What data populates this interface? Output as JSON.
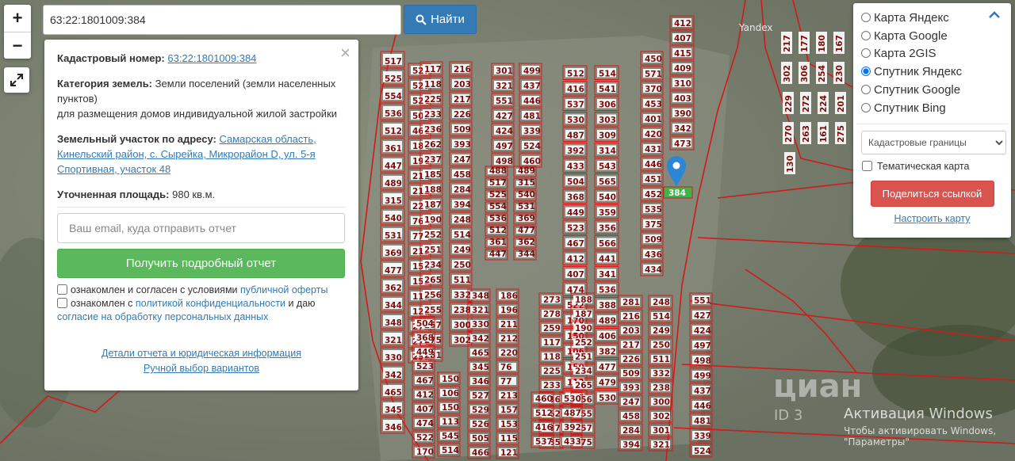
{
  "map": {
    "yandex_logo": "Yandex",
    "marker_label": "384",
    "plot_labels": [
      "517",
      "525",
      "554",
      "536",
      "512",
      "361",
      "447",
      "489",
      "315",
      "540",
      "531",
      "369",
      "477",
      "362",
      "344",
      "348",
      "321",
      "330",
      "342",
      "465",
      "345",
      "346",
      "527",
      "529",
      "526",
      "505",
      "466",
      "186",
      "196",
      "211",
      "212",
      "220",
      "76",
      "77",
      "213",
      "157",
      "153",
      "115",
      "121",
      "273",
      "278",
      "259",
      "117",
      "118",
      "225",
      "233",
      "236",
      "262",
      "237",
      "185",
      "188",
      "187",
      "190",
      "252",
      "251",
      "234",
      "265",
      "256",
      "255",
      "257",
      "275",
      "281",
      "216",
      "203",
      "217",
      "226",
      "509",
      "393",
      "247",
      "458",
      "284",
      "394",
      "248",
      "514",
      "249",
      "250",
      "511",
      "332",
      "238",
      "300",
      "302",
      "301",
      "321",
      "551",
      "427",
      "424",
      "497",
      "498",
      "499",
      "437",
      "446",
      "481",
      "339",
      "524",
      "460",
      "512",
      "416",
      "537",
      "530",
      "487",
      "392",
      "433",
      "504",
      "368",
      "449",
      "523",
      "467",
      "412",
      "407",
      "474",
      "522",
      "170",
      "150",
      "106",
      "150",
      "113",
      "545",
      "514",
      "541",
      "306",
      "303",
      "309",
      "314",
      "543",
      "565",
      "540",
      "359",
      "356",
      "566",
      "441",
      "341",
      "536",
      "388",
      "489",
      "406",
      "382",
      "477",
      "479",
      "530",
      "450",
      "571",
      "370",
      "453",
      "401",
      "420",
      "431",
      "446",
      "451",
      "452",
      "535",
      "375",
      "509",
      "436",
      "434",
      "412",
      "407",
      "415",
      "409",
      "310",
      "403",
      "390",
      "342",
      "473",
      "488"
    ],
    "right_labels": [
      "217",
      "177",
      "180",
      "167",
      "302",
      "306",
      "254",
      "230",
      "229",
      "272",
      "224",
      "201",
      "270",
      "263",
      "161",
      "275",
      "130"
    ]
  },
  "zoom": {
    "in": "+",
    "out": "−"
  },
  "search": {
    "value": "63:22:1801009:384",
    "button": "Найти"
  },
  "info": {
    "cadastral_label": "Кадастровый номер:",
    "cadastral_value": "63:22:1801009:384",
    "category_label": "Категория земель:",
    "category_value": "Земли поселений (земли населенных пунктов)",
    "usage_value": "для размещения домов индивидуальной жилой застройки",
    "address_label": "Земельный участок по адресу:",
    "address_value": "Самарская область, Кинельский район, с. Сырейка, Микрорайон D, ул. 5-я Спортивная, участок 48",
    "area_label": "Уточненная площадь:",
    "area_value": "980 кв.м.",
    "email_placeholder": "Ваш email, куда отправить отчет",
    "report_button": "Получить подробный отчет",
    "agree1_text": "ознакомлен и согласен с условиями",
    "agree1_link": "публичной оферты",
    "agree2_text": "ознакомлен с",
    "agree2_link": "политикой конфиденциальности",
    "agree2_mid": "и даю",
    "agree2_link2": "согласие на обработку персональных данных",
    "details_link": "Детали отчета и юридическая информация",
    "manual_link": "Ручной выбор вариантов"
  },
  "layers": {
    "options": [
      "Карта Яндекс",
      "Карта Google",
      "Карта 2GIS",
      "Спутник Яндекс",
      "Спутник Google",
      "Спутник Bing"
    ],
    "selected": "Спутник Яндекс",
    "boundaries_select": "Кадастровые границы",
    "thematic_label": "Тематическая карта",
    "share_button": "Поделиться ссылкой",
    "setup_link": "Настроить карту"
  },
  "watermarks": {
    "cian": "циан",
    "cian_id": "ID 3",
    "win_title": "Активация Windows",
    "win_line2": "Чтобы активировать Windows,",
    "win_line3": "\"Параметры\""
  },
  "colors": {
    "boundary": "#d11a1a",
    "search_button": "#337ab7",
    "report_button": "#5cb85c",
    "share_button": "#d9534f",
    "marker": "#2b86d6"
  }
}
